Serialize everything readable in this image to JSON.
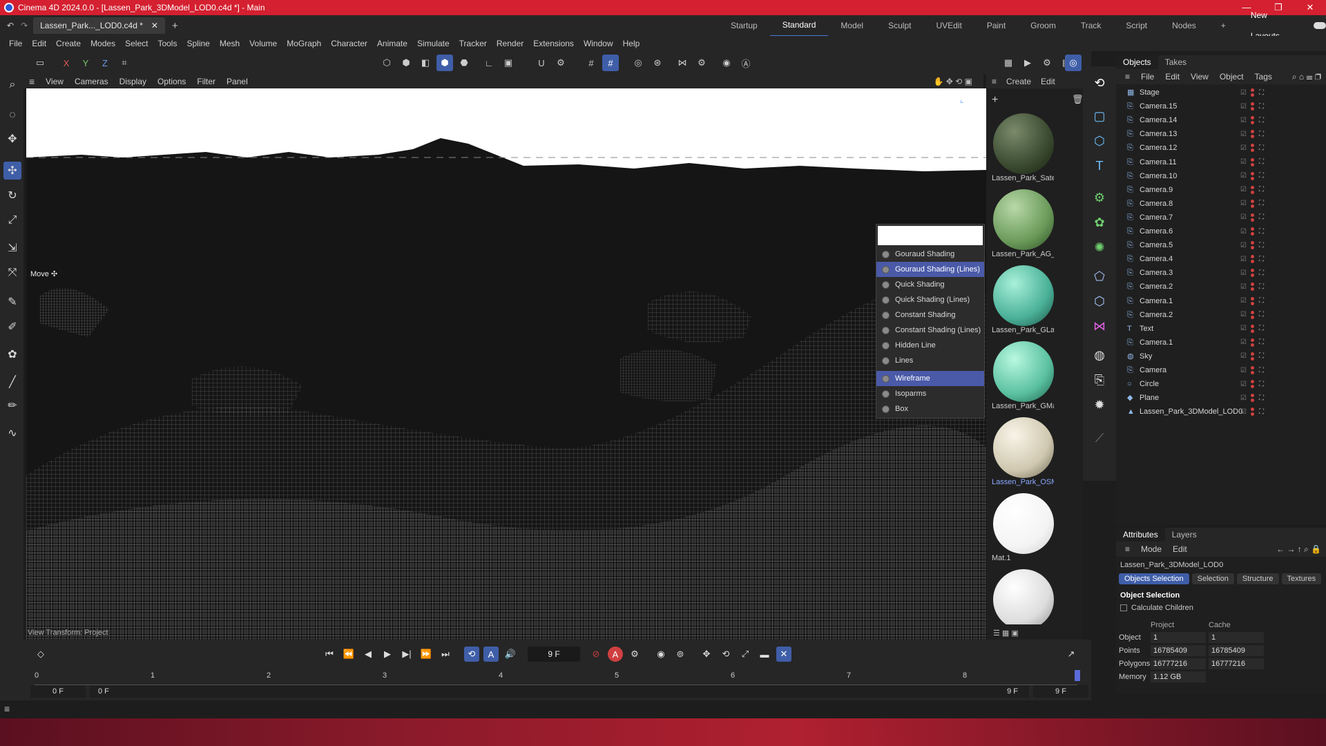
{
  "window": {
    "title": "Cinema 4D 2024.0.0 - [Lassen_Park_3DModel_LOD0.c4d *] - Main",
    "controls": [
      "—",
      "❐",
      "✕"
    ]
  },
  "tabs": {
    "doc_tab": "Lassen_Park..._LOD0.c4d *",
    "layouts": [
      "Startup",
      "Standard",
      "Model",
      "Sculpt",
      "UVEdit",
      "Paint",
      "Groom",
      "Track",
      "Script",
      "Nodes"
    ],
    "active_layout": "Standard",
    "new_layouts": "New Layouts"
  },
  "menubar": [
    "File",
    "Edit",
    "Create",
    "Modes",
    "Select",
    "Tools",
    "Spline",
    "Mesh",
    "Volume",
    "MoGraph",
    "Character",
    "Animate",
    "Simulate",
    "Tracker",
    "Render",
    "Extensions",
    "Window",
    "Help"
  ],
  "toolbar": {
    "axis_x": "X",
    "axis_y": "Y",
    "axis_z": "Z"
  },
  "viewport": {
    "menu": [
      "View",
      "Cameras",
      "Display",
      "Options",
      "Filter",
      "Panel"
    ],
    "move_label": "Move ✣",
    "bottom_left": "View Transform: Project",
    "shading_menu": [
      "Gouraud Shading",
      "Gouraud Shading (Lines)",
      "Quick Shading",
      "Quick Shading (Lines)",
      "Constant Shading",
      "Constant Shading (Lines)",
      "Hidden Line",
      "Lines",
      "Wireframe",
      "Isoparms",
      "Box"
    ],
    "selected_shading": [
      "Gouraud Shading (Lines)",
      "Wireframe"
    ]
  },
  "materials": {
    "menu": [
      "Create",
      "Edit"
    ],
    "items": [
      "Lassen_Park_Satel",
      "Lassen_Park_AG_L",
      "Lassen_Park_GLan",
      "Lassen_Park_GMa",
      "Lassen_Park_OSM",
      "Mat.1",
      ""
    ],
    "selected": "Lassen_Park_OSM"
  },
  "objects": {
    "tabs": [
      "Objects",
      "Takes"
    ],
    "menu": [
      "File",
      "Edit",
      "View",
      "Object",
      "Tags"
    ],
    "rows": [
      {
        "name": "Stage",
        "icon": "stage-icon"
      },
      {
        "name": "Camera.15",
        "icon": "camera-icon"
      },
      {
        "name": "Camera.14",
        "icon": "camera-icon"
      },
      {
        "name": "Camera.13",
        "icon": "camera-icon"
      },
      {
        "name": "Camera.12",
        "icon": "camera-icon"
      },
      {
        "name": "Camera.11",
        "icon": "camera-icon"
      },
      {
        "name": "Camera.10",
        "icon": "camera-icon"
      },
      {
        "name": "Camera.9",
        "icon": "camera-icon"
      },
      {
        "name": "Camera.8",
        "icon": "camera-icon"
      },
      {
        "name": "Camera.7",
        "icon": "camera-icon"
      },
      {
        "name": "Camera.6",
        "icon": "camera-icon"
      },
      {
        "name": "Camera.5",
        "icon": "camera-icon"
      },
      {
        "name": "Camera.4",
        "icon": "camera-icon"
      },
      {
        "name": "Camera.3",
        "icon": "camera-icon"
      },
      {
        "name": "Camera.2",
        "icon": "camera-icon"
      },
      {
        "name": "Camera.1",
        "icon": "camera-icon"
      },
      {
        "name": "Camera.2",
        "icon": "camera-icon"
      },
      {
        "name": "Text",
        "icon": "text-icon"
      },
      {
        "name": "Camera.1",
        "icon": "camera-icon"
      },
      {
        "name": "Sky",
        "icon": "sky-icon"
      },
      {
        "name": "Camera",
        "icon": "camera-icon"
      },
      {
        "name": "Circle",
        "icon": "circle-icon"
      },
      {
        "name": "Plane",
        "icon": "plane-icon"
      },
      {
        "name": "Lassen_Park_3DModel_LOD0",
        "icon": "polygon-object-icon"
      }
    ]
  },
  "attributes": {
    "tabs": [
      "Attributes",
      "Layers"
    ],
    "menu": [
      "Mode",
      "Edit"
    ],
    "object_name": "Lassen_Park_3DModel_LOD0",
    "segments": [
      "Objects Selection",
      "Selection",
      "Structure",
      "Textures"
    ],
    "section_title": "Object Selection",
    "checkbox": "Calculate Children",
    "col_project": "Project",
    "col_cache": "Cache",
    "rows": [
      {
        "label": "Object",
        "project": "1",
        "cache": "1"
      },
      {
        "label": "Points",
        "project": "16785409",
        "cache": "16785409"
      },
      {
        "label": "Polygons",
        "project": "16777216",
        "cache": "16777216"
      },
      {
        "label": "Memory",
        "project": "1.12 GB",
        "cache": ""
      }
    ]
  },
  "timeline": {
    "current_frame": "9 F",
    "start_field": "0 F",
    "start_field2": "0 F",
    "end_field": "9 F",
    "end_field2": "9 F",
    "ticks": [
      "0",
      "1",
      "2",
      "3",
      "4",
      "5",
      "6",
      "7",
      "8"
    ]
  },
  "colors": {
    "titlebar": "#d42030",
    "accent": "#3f5ea8",
    "selected_text": "#8aa9ff"
  }
}
